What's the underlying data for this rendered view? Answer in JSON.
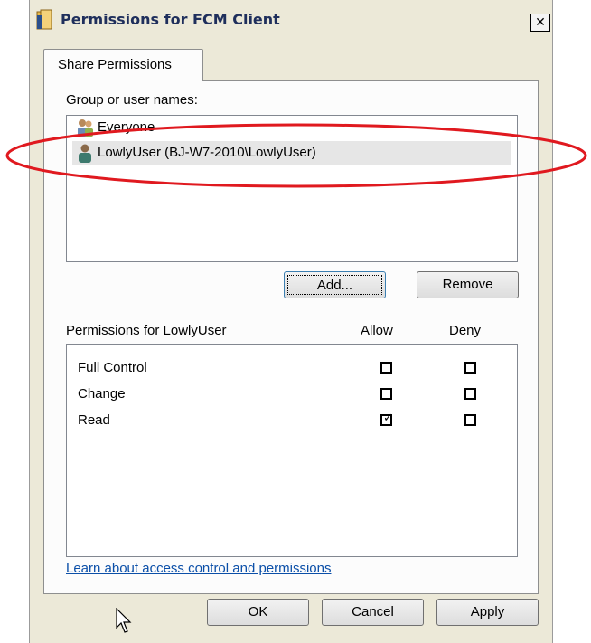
{
  "window": {
    "title": "Permissions for FCM Client",
    "close_label": "✕"
  },
  "tabs": [
    {
      "label": "Share Permissions",
      "active": true
    }
  ],
  "group_section": {
    "label": "Group or user names:",
    "items": [
      {
        "label": "Everyone",
        "icon": "group-icon",
        "selected": false
      },
      {
        "label": "LowlyUser (BJ-W7-2010\\LowlyUser)",
        "icon": "user-icon",
        "selected": true
      }
    ]
  },
  "buttons": {
    "add": "Add...",
    "remove": "Remove",
    "ok": "OK",
    "cancel": "Cancel",
    "apply": "Apply"
  },
  "permissions": {
    "label": "Permissions for LowlyUser",
    "allow_header": "Allow",
    "deny_header": "Deny",
    "rows": [
      {
        "name": "Full Control",
        "allow": false,
        "deny": false
      },
      {
        "name": "Change",
        "allow": false,
        "deny": false
      },
      {
        "name": "Read",
        "allow": true,
        "deny": false
      }
    ]
  },
  "link": {
    "label": "Learn about access control and permissions"
  },
  "colors": {
    "annotation": "#e0191f",
    "dialog_bg": "#ece9d8",
    "link": "#0b4fa8"
  }
}
